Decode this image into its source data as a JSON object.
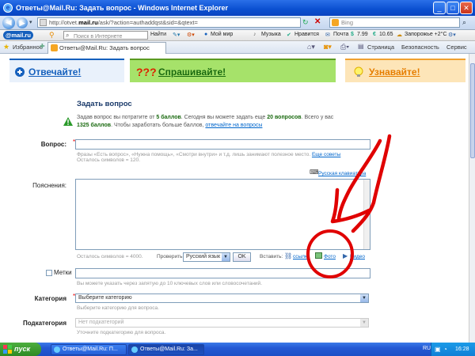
{
  "window": {
    "title": "Ответы@Mail.Ru: Задать вопрос - Windows Internet Explorer"
  },
  "address_bar": {
    "url_prefix": "http://otvet.",
    "url_domain": "mail.ru",
    "url_suffix": "/ask/?action=authaddqst&sid=&qtext=",
    "search_placeholder": "Bing"
  },
  "mail_toolbar": {
    "logo": "@mail.ru",
    "search_placeholder": "Поиск в Интернете",
    "find_label": "Найти",
    "my_world": "Мой мир",
    "music": "Музыка",
    "likes": "Нравится",
    "mail": "Почта",
    "currency_usd": "7.99",
    "currency_eur": "10.65",
    "weather": "Запорожье +2°C"
  },
  "favorites_bar": {
    "favorites_label": "Избранное",
    "tab_title": "Ответы@Mail.Ru: Задать вопрос",
    "page_menu": "Страница",
    "safety_menu": "Безопасность",
    "service_menu": "Сервис"
  },
  "banners": {
    "answer": "Отвечайте!",
    "ask": "Спрашивайте!",
    "learn": "Узнавайте!"
  },
  "form": {
    "heading": "Задать вопрос",
    "info_line1_a": "Задав вопрос вы потратите от ",
    "info_points": "5 баллов",
    "info_line1_b": ". Сегодня вы можете задать еще ",
    "info_questions": "20 вопросов",
    "info_line1_c": ". Всего у вас",
    "info_total": "1325 баллов",
    "info_line2": ". Чтобы заработать больше баллов, ",
    "info_link": "отвечайте на вопросы",
    "question_label": "Вопрос:",
    "question_hint": "Фразы «Есть вопрос», «Нужна помощь», «Смотри внутри» и т.д. лишь занимают полезное место. ",
    "question_hint_link": "Еще советы",
    "question_remaining": "Осталось символов = 120.",
    "keyboard_link": "Русская клавиатура",
    "explain_label": "Пояснения:",
    "explain_remaining": "Осталось символов = 4000.",
    "check_label": "Проверить:",
    "language_value": "Русский язык",
    "ok_label": "OK",
    "insert_label": "Вставить:",
    "insert_link": "ссылку",
    "insert_photo": "Фото",
    "insert_video": "Видео",
    "tags_label": "Метки",
    "tags_hint": "Вы можете указать через запятую до 10 ключевых слов или словосочетаний.",
    "category_label": "Категория",
    "category_value": "Выберите категорию",
    "category_hint": "Выберите категорию для вопроса.",
    "subcategory_label": "Подкатегория",
    "subcategory_value": "Нет подкатегорий",
    "subcategory_hint": "Уточните подкатегорию для вопроса."
  },
  "taskbar": {
    "start_label": "пуск",
    "task1": "Ответы@Mail.Ru: П...",
    "task2": "Ответы@Mail.Ru: За...",
    "lang": "RU",
    "time": "16:28"
  },
  "colors": {
    "annotation": "#e00000",
    "answer_banner": "#e9f1fb",
    "ask_banner": "#a6e26a",
    "learn_banner": "#fde5b8",
    "link": "#0066cc"
  }
}
